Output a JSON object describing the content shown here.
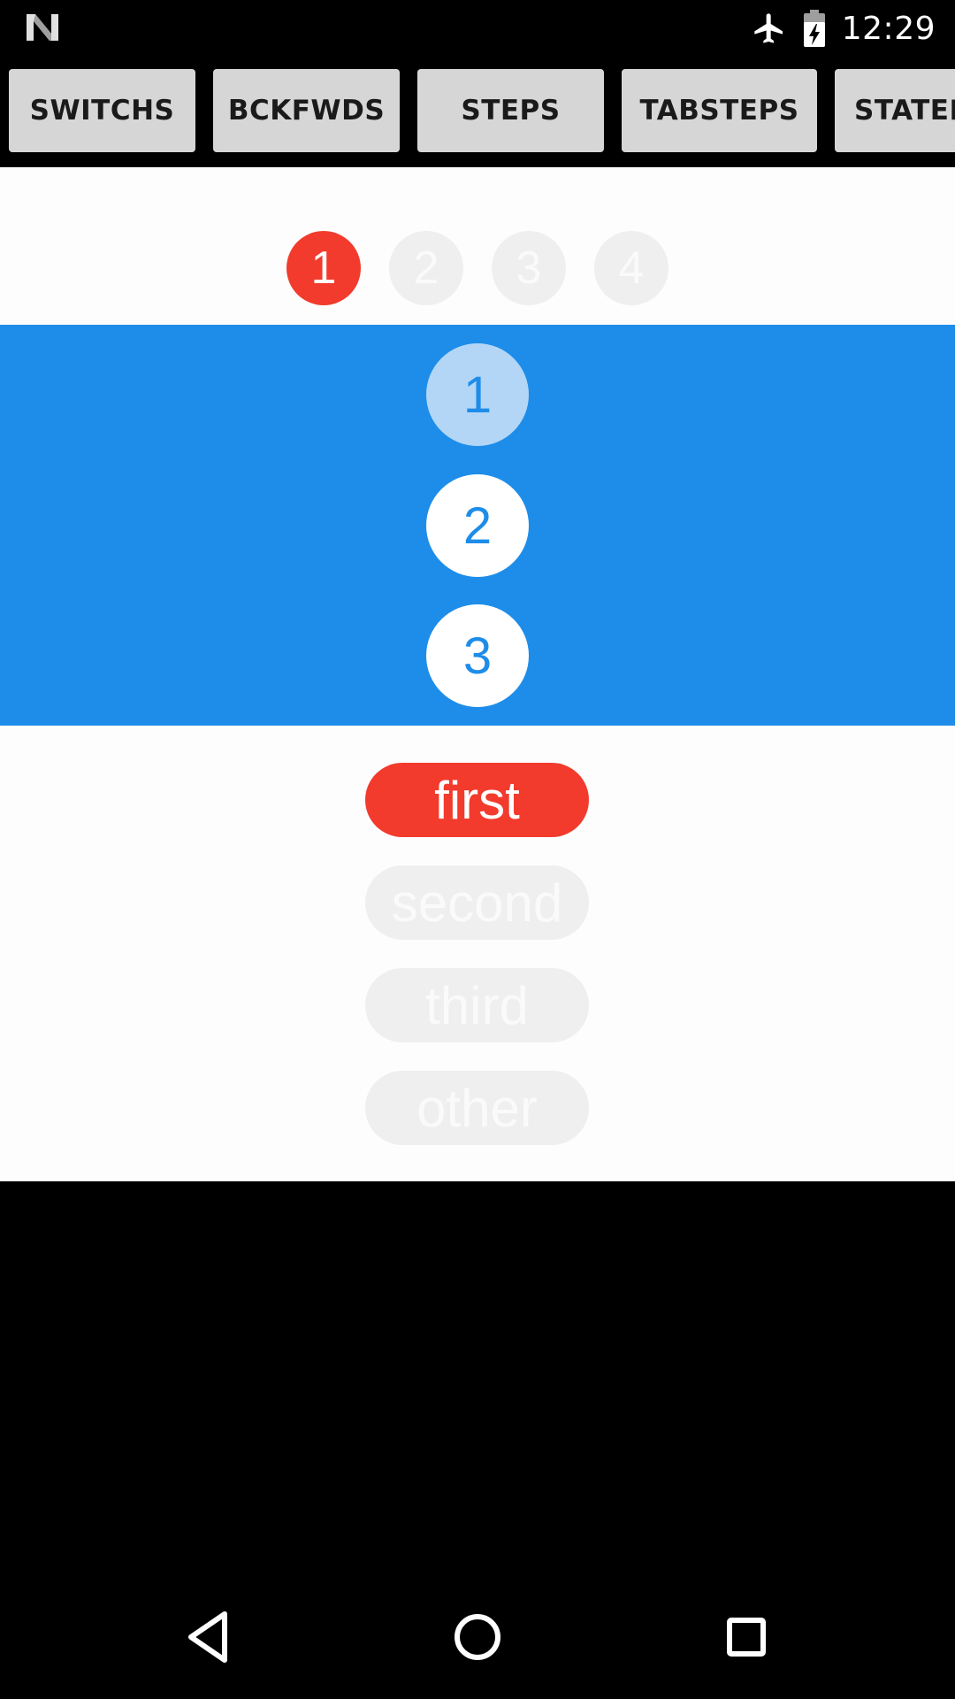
{
  "status_bar": {
    "time": "12:29",
    "icons": [
      "notification-n-icon",
      "airplane-mode-icon",
      "battery-charging-icon"
    ]
  },
  "toolbar": {
    "buttons": [
      "SWITCHS",
      "BCKFWDS",
      "STEPS",
      "TABSTEPS",
      "STATEF"
    ]
  },
  "horizontal_stepper": {
    "steps": [
      "1",
      "2",
      "3",
      "4"
    ],
    "active_index": 0,
    "colors": {
      "active": "#f23b2d",
      "inactive": "#efefef"
    }
  },
  "vertical_stepper": {
    "steps": [
      "1",
      "2",
      "3"
    ],
    "active_index": 0,
    "colors": {
      "background": "#1e8de9",
      "active": "#b3d6f6",
      "normal": "#ffffff"
    }
  },
  "pill_tabs": {
    "items": [
      "first",
      "second",
      "third",
      "other"
    ],
    "active_index": 0
  },
  "nav_bar": {
    "icons": [
      "back-icon",
      "home-icon",
      "recents-icon"
    ]
  }
}
